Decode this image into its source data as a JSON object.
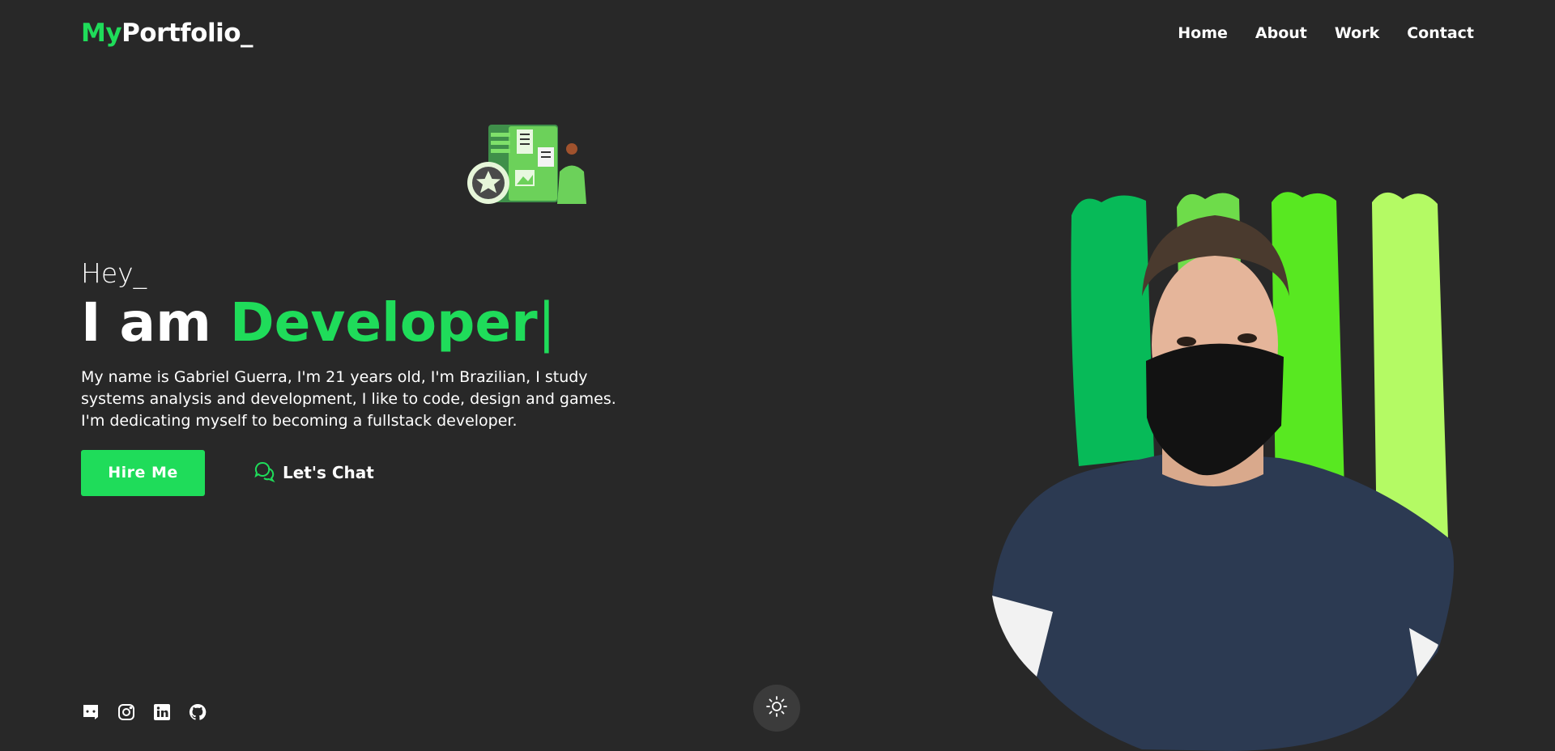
{
  "header": {
    "logo_accent": "My",
    "logo_rest": "Portfolio_",
    "nav": [
      "Home",
      "About",
      "Work",
      "Contact"
    ]
  },
  "hero": {
    "greeting": "Hey_",
    "headline_prefix": "I am",
    "headline_role": "Developer",
    "cursor": "|",
    "bio": "My name is Gabriel Guerra, I'm 21 years old, I'm Brazilian, I study systems analysis and development, I like to code, design and games. I'm dedicating myself to becoming a fullstack developer.",
    "hire_button": "Hire Me",
    "chat_button": "Let's Chat"
  },
  "social_icons": [
    "discord-icon",
    "instagram-icon",
    "linkedin-icon",
    "github-icon"
  ],
  "theme_toggle_icon": "sun-icon",
  "colors": {
    "background": "#282828",
    "accent": "#1fdc5a",
    "text": "#ffffff"
  }
}
